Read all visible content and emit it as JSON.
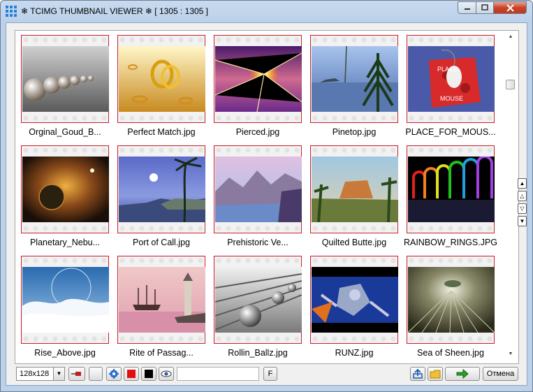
{
  "window": {
    "title": "TCIMG THUMBNAIL VIEWER",
    "title_counter": "[ 1305 : 1305 ]",
    "title_symbol": "❄"
  },
  "thumbnails": [
    {
      "name": "Orginal_Goud_B...",
      "scene": "pearls"
    },
    {
      "name": "Perfect Match.jpg",
      "scene": "rings"
    },
    {
      "name": "Pierced.jpg",
      "scene": "burst"
    },
    {
      "name": "Pinetop.jpg",
      "scene": "pine"
    },
    {
      "name": "PLACE_FOR_MOUS...",
      "scene": "mouse"
    },
    {
      "name": "Planetary_Nebu...",
      "scene": "nebula"
    },
    {
      "name": "Port of Call.jpg",
      "scene": "palm"
    },
    {
      "name": "Prehistoric Ve...",
      "scene": "valley"
    },
    {
      "name": "Quilted Butte.jpg",
      "scene": "butte"
    },
    {
      "name": "RAINBOW_RINGS.JPG",
      "scene": "rainbow"
    },
    {
      "name": "Rise_Above.jpg",
      "scene": "clouds"
    },
    {
      "name": "Rite of Passag...",
      "scene": "lighthouse"
    },
    {
      "name": "Rollin_Ballz.jpg",
      "scene": "balls"
    },
    {
      "name": "RUNZ.jpg",
      "scene": "robot"
    },
    {
      "name": "Sea of Sheen.jpg",
      "scene": "tunnel"
    }
  ],
  "toolbar": {
    "size_value": "128x128",
    "f_label": "F",
    "cancel_label": "Отмена",
    "search_value": ""
  },
  "colors": {
    "red_swatch": "#e01010",
    "black_swatch": "#000000",
    "thumb_border": "#c8202a"
  }
}
